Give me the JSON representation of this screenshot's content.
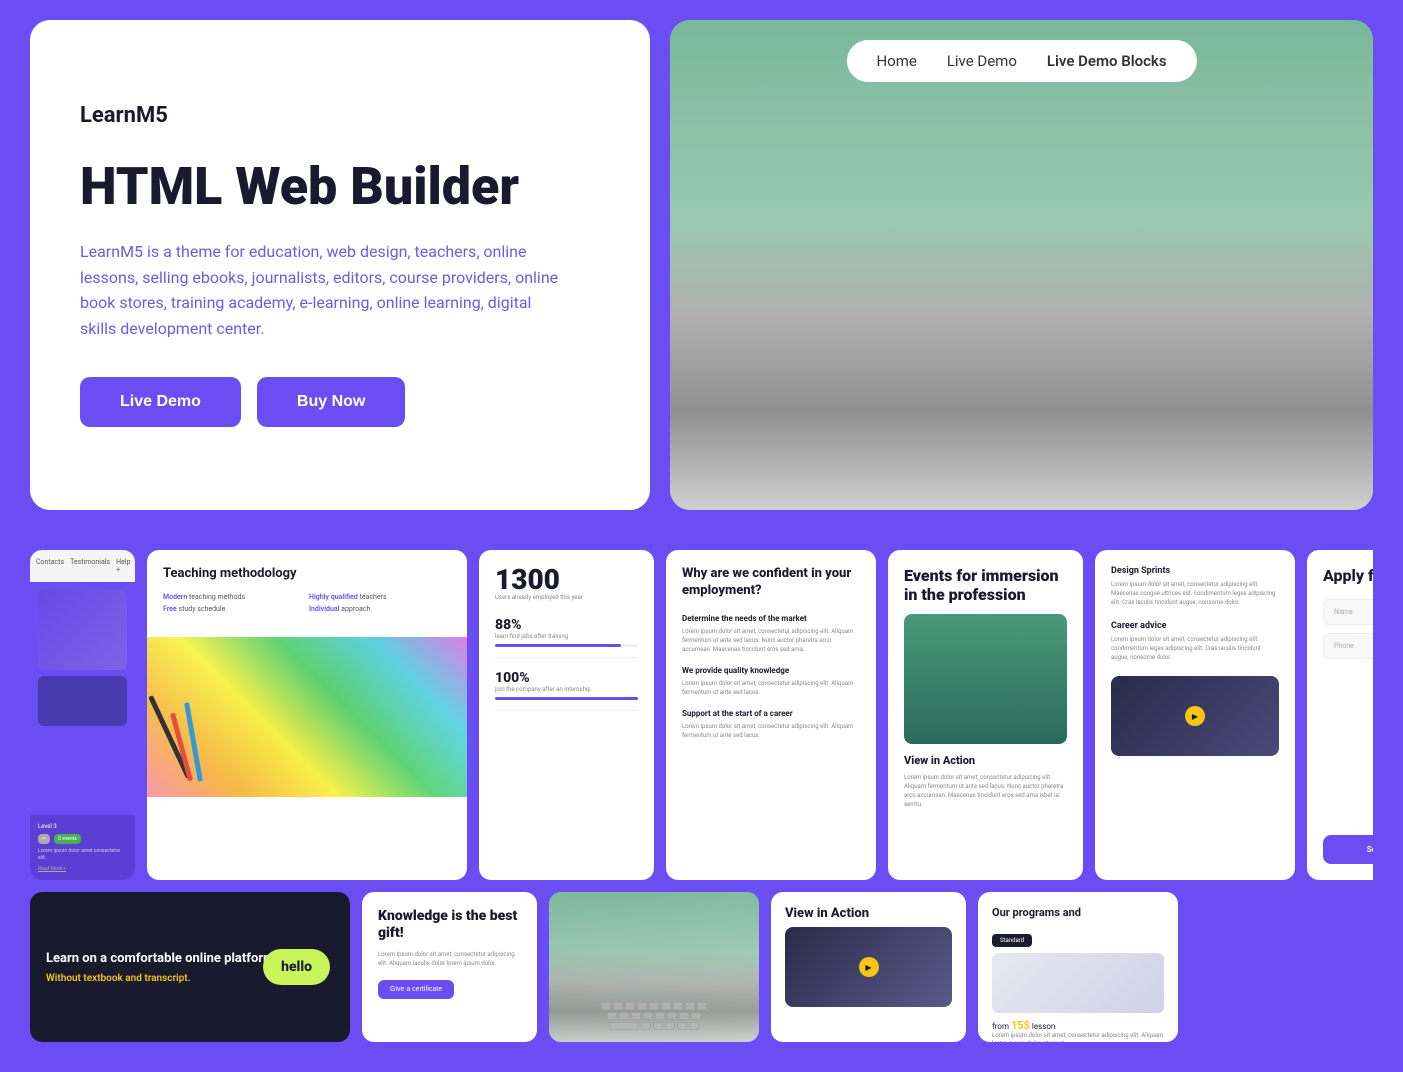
{
  "hero": {
    "logo": "LearnM5",
    "title": "HTML Web Builder",
    "description": "LearnM5 is a theme for education, web design, teachers, online lessons, selling ebooks, journalists, editors, course providers, online book stores, training academy, e-learning, online learning, digital skills development center.",
    "btn_live_demo": "Live Demo",
    "btn_buy_now": "Buy Now"
  },
  "nav": {
    "items": [
      {
        "label": "Home"
      },
      {
        "label": "Live Demo"
      },
      {
        "label": "Live Demo Blocks"
      }
    ]
  },
  "blocks": {
    "teaching": {
      "title": "Teaching methodology",
      "features": [
        {
          "label": "Modern teaching methods"
        },
        {
          "label": "Highly qualified teachers"
        },
        {
          "label": "Free study schedule"
        },
        {
          "label": "Individual approach"
        }
      ]
    },
    "stats": {
      "number": "1300",
      "subtitle": "Users already employed this year",
      "rows": [
        {
          "percent": "88%",
          "label": "learn find jobs after training",
          "fill": 88
        },
        {
          "percent": "100%",
          "label": "join the company after an internship",
          "fill": 100
        }
      ]
    },
    "confident": {
      "title": "Why are we confident in your employment?",
      "items": [
        {
          "title": "Determine the needs of the market",
          "text": "Lorem ipsum dolor sit amet, consectetur adipiscing elit. Aliquam fermentum ut ante sed lacus. Nunc auctor pharetra arcu accumsan. Maecenas tincidunt eros sed ama isbet ia senrtu."
        },
        {
          "title": "We provide quality knowledge",
          "text": "Lorem ipsum dolor sit amet, consectetur adipiscing elit. Aliquam fermentum ut ante sed lacus."
        },
        {
          "title": "Support at the start of a career",
          "text": "Lorem ipsum dolor sit amet, consectetur adipiscing elit. Aliquam fermentum ut ante sed lacus."
        }
      ]
    },
    "events": {
      "title": "Events for immersion in the profession",
      "view_title": "View in Action",
      "view_desc": "Lorem ipsum dolor sit amet, consectetur adipiscing elit. Aliquam fermentum ut ante sed lacus. Nunc auctor pharetra arcu accumsan. Maecenas tincidunt eros sed ama isbet ia senrtu."
    },
    "design": {
      "items": [
        {
          "title": "Design Sprints",
          "text": "Lorem ipsum dolor sit amet, consectetur adipiscing elit. Maecenas congue ultrices est. condimentum leges adipiscing elit. Cras iaculis tincidunt augue, nonsome dolor."
        },
        {
          "title": "Career advice",
          "text": "Lorem ipsum dolor sit amet, consectetur adipiscing elit. condimentum leges adipiscing elit. Cras iaculis tincidunt augue, nonsome dolor."
        }
      ]
    },
    "apply": {
      "title": "Apply for study",
      "fields": [
        "Name",
        "Phone"
      ],
      "btn": "Send an application"
    },
    "online": {
      "title": "Learn on a comfortable online platform.",
      "subtitle": "Without textbook and transcript.",
      "hello_badge": "hello"
    },
    "knowledge": {
      "title": "Knowledge is the best gift!",
      "text": "Lorem ipsum dolor sit amet, consectetur adipiscing elit. Aliquam iaculis dolor lorem ipsum dolor.",
      "btn": "Give a certificate"
    },
    "programs": {
      "title": "Our programs and",
      "badge": "Standard",
      "price_label": "from",
      "price": "15$",
      "price_suffix": "lesson",
      "desc": "Lorem ipsum dolor sit amet, consectetur adipiscing elit. Aliquam lorem ipsum dolor sit amet, adipiscing elit."
    },
    "sidebar": {
      "tabs": [
        "Contacts",
        "Testimonials",
        "Help"
      ],
      "level": "Level 3",
      "events_badge": "0 events",
      "text": "Lorem ipsum dolor amet consectetur elit.",
      "link": "Read More +"
    }
  }
}
